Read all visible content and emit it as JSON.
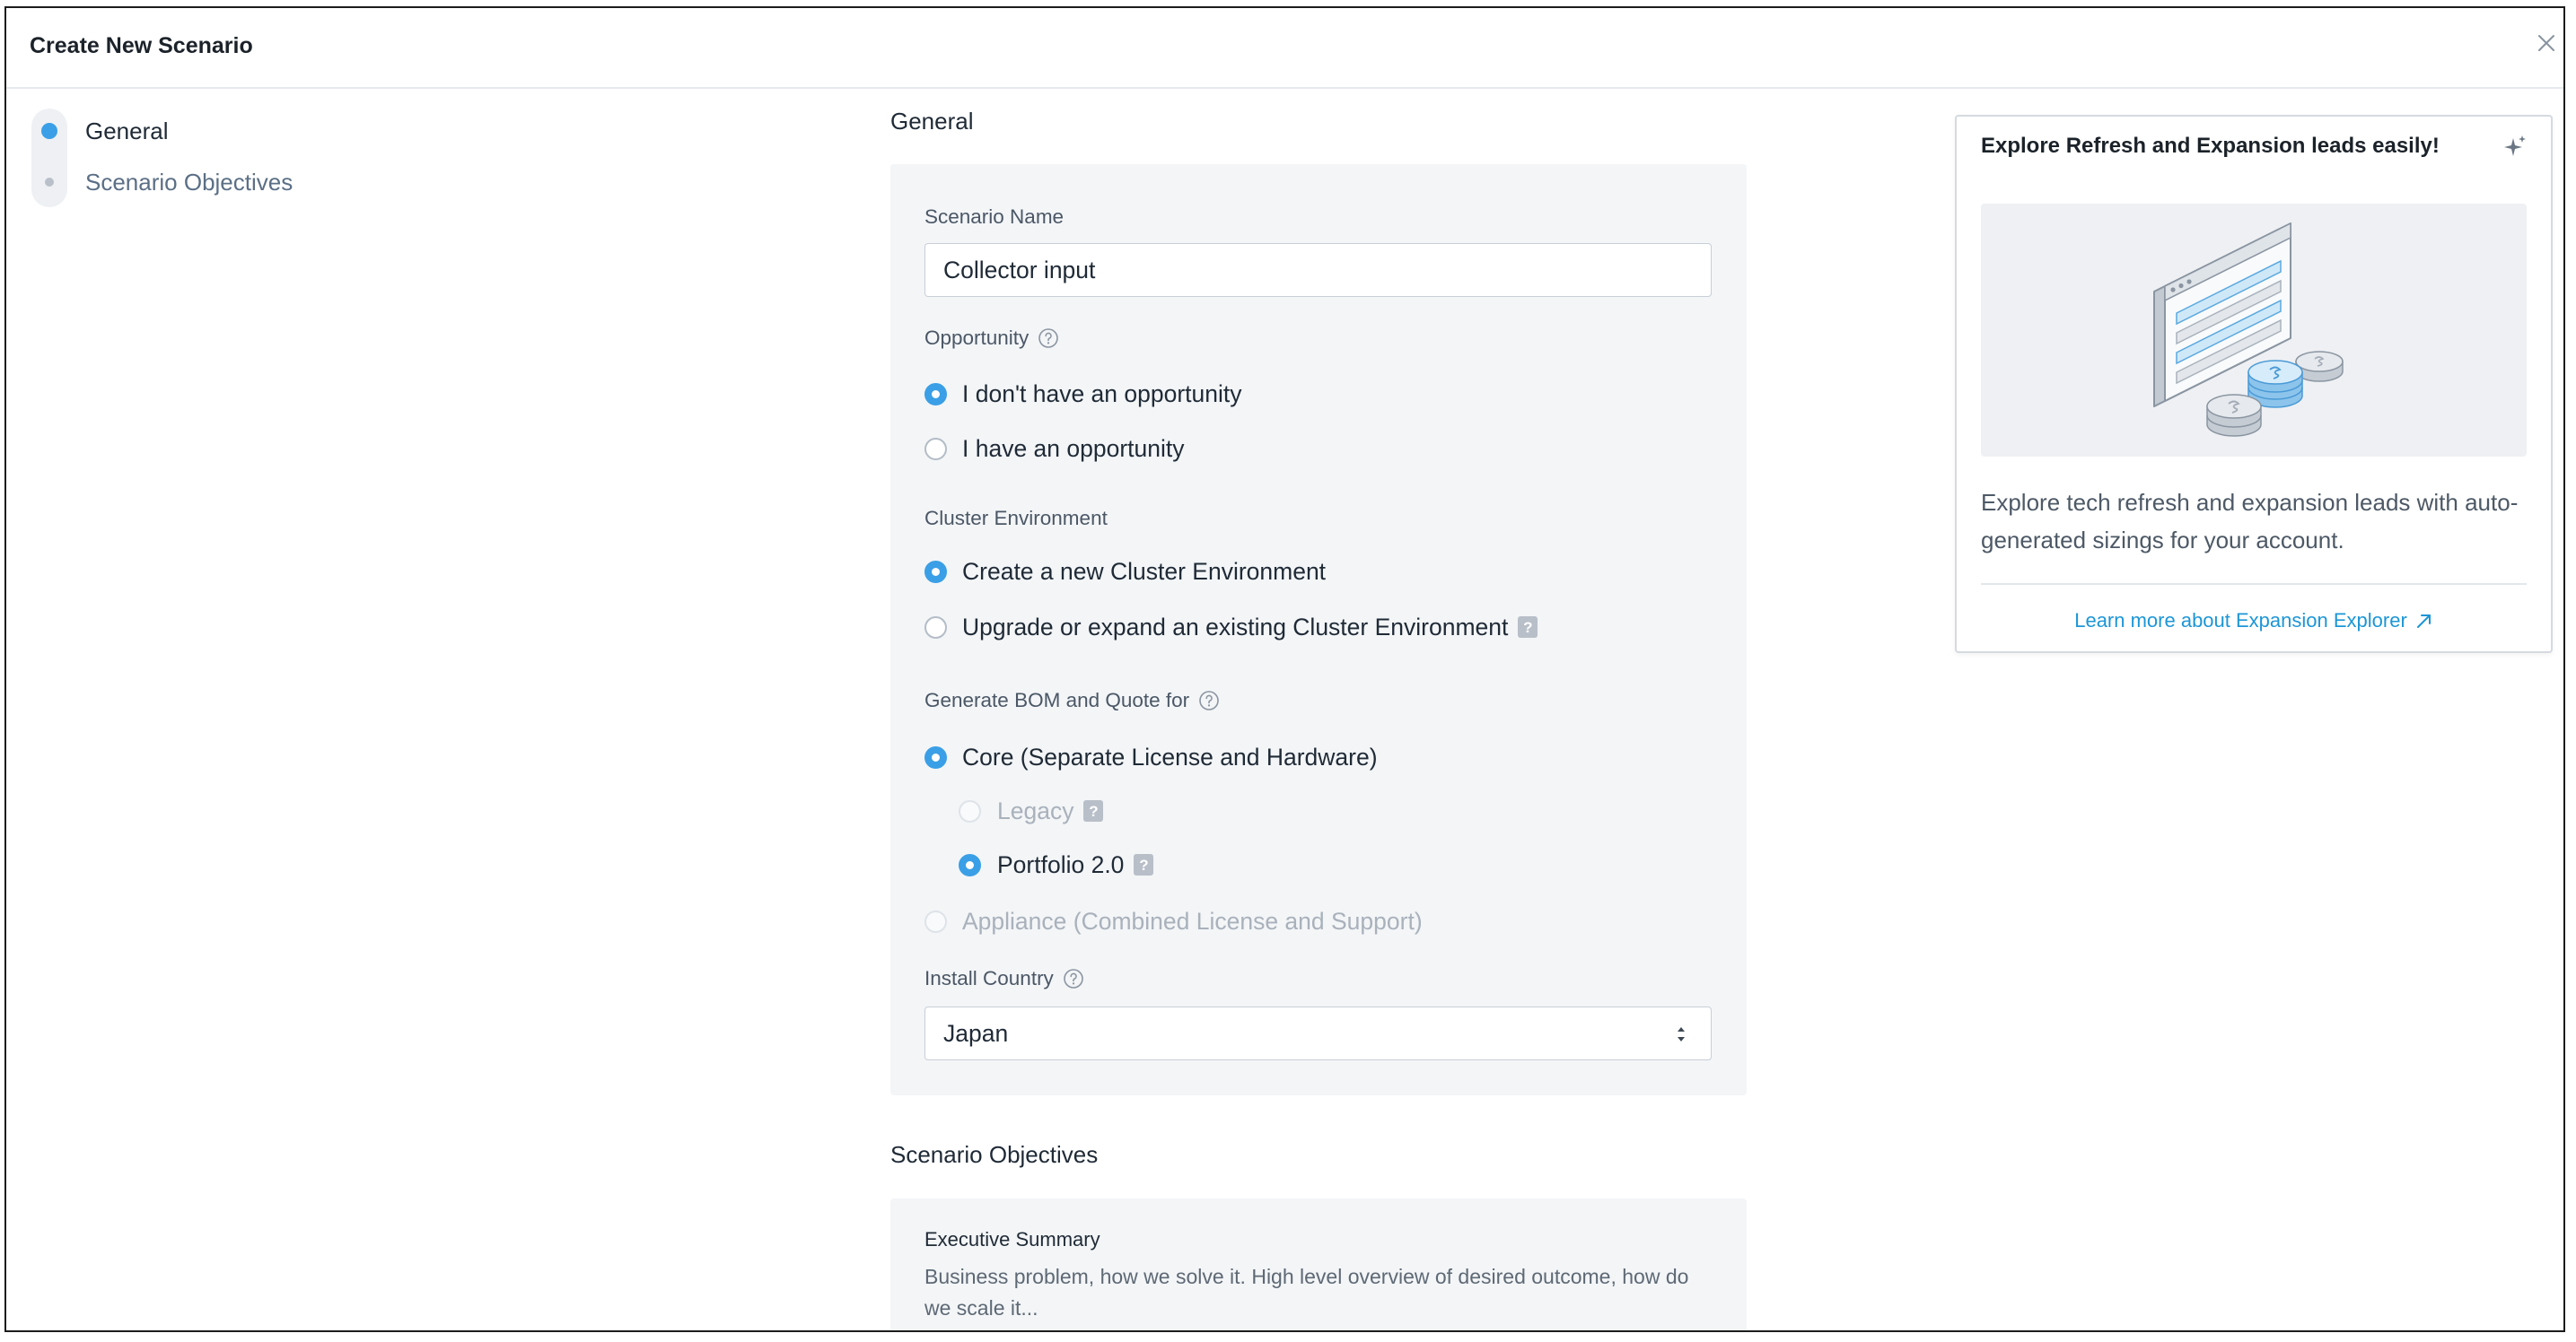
{
  "modal": {
    "title": "Create New Scenario",
    "close_icon": "close-icon"
  },
  "steps": [
    {
      "label": "General",
      "active": true
    },
    {
      "label": "Scenario Objectives",
      "active": false
    }
  ],
  "general": {
    "heading": "General",
    "scenario_name": {
      "label": "Scenario Name",
      "value": "Collector input"
    },
    "opportunity": {
      "label": "Opportunity",
      "help_icon": "help-circle-icon",
      "options": [
        {
          "label": "I don't have an opportunity",
          "selected": true,
          "disabled": false
        },
        {
          "label": "I have an opportunity",
          "selected": false,
          "disabled": false
        }
      ]
    },
    "cluster_environment": {
      "label": "Cluster Environment",
      "options": [
        {
          "label": "Create a new Cluster Environment",
          "selected": true,
          "disabled": false
        },
        {
          "label": "Upgrade or expand an existing Cluster Environment",
          "selected": false,
          "disabled": false,
          "badge": "?"
        }
      ]
    },
    "bom_quote": {
      "label": "Generate BOM and Quote for",
      "help_icon": "help-circle-icon",
      "options": [
        {
          "label": "Core (Separate License and Hardware)",
          "selected": true,
          "disabled": false,
          "sub_options": [
            {
              "label": "Legacy",
              "selected": false,
              "disabled": true,
              "badge": "?"
            },
            {
              "label": "Portfolio 2.0",
              "selected": true,
              "disabled": false,
              "badge": "?"
            }
          ]
        },
        {
          "label": "Appliance (Combined License and Support)",
          "selected": false,
          "disabled": true
        }
      ]
    },
    "install_country": {
      "label": "Install Country",
      "help_icon": "help-circle-icon",
      "value": "Japan",
      "select_icon": "up-down-arrows-icon"
    }
  },
  "objectives": {
    "heading": "Scenario Objectives",
    "executive_summary": {
      "label": "Executive Summary",
      "placeholder": "Business problem, how we solve it. High level overview of desired outcome, how do we scale it..."
    }
  },
  "promo": {
    "title": "Explore Refresh and Expansion leads easily!",
    "icon": "sparkle-icon",
    "illustration": "browser-window-coins-illustration",
    "body": "Explore tech refresh and expansion leads with auto-generated sizings for your account.",
    "link": "Learn more about Expansion Explorer",
    "link_icon": "external-arrow-icon"
  },
  "colors": {
    "accent": "#3a9fe6",
    "link": "#1d96d6",
    "text": "#1f2a36",
    "label": "#4b5766",
    "nav_inactive": "#5b6f86",
    "disabled": "#a9b1bb",
    "card_bg": "#f3f5f7",
    "badge": "#b8bfc8",
    "placeholder": "#5e6975"
  }
}
